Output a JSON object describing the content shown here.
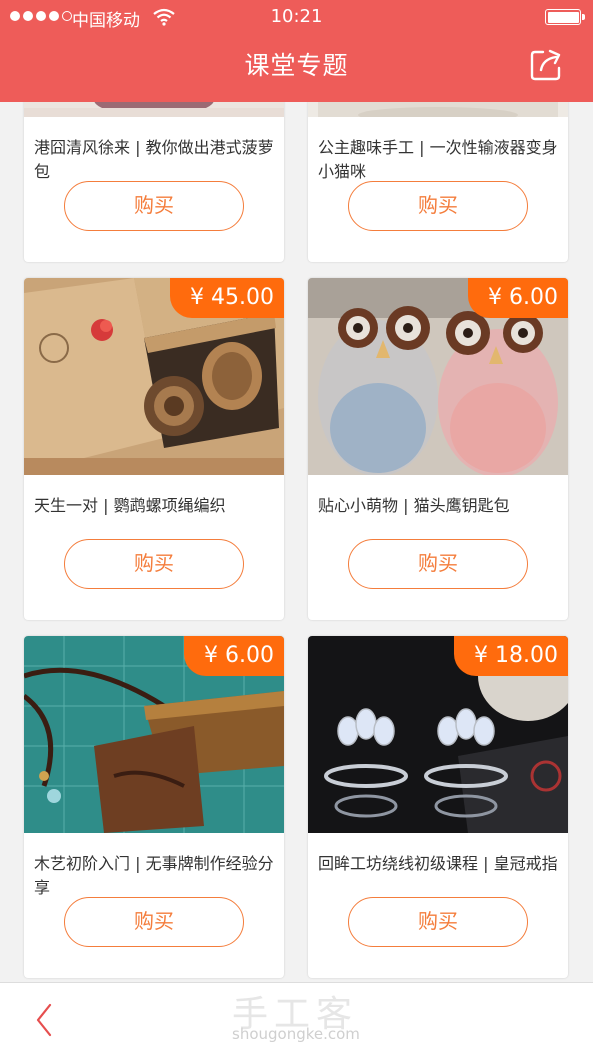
{
  "status_bar": {
    "carrier": "中国移动",
    "time": "10:21"
  },
  "header": {
    "title": "课堂专题",
    "share_icon": "share-icon"
  },
  "courses": [
    {
      "title": "港囧清风徐来 | 教你做出港式菠萝包",
      "price": "",
      "buy_label": "购买"
    },
    {
      "title": "公主趣味手工 | 一次性输液器变身小猫咪",
      "price": "",
      "buy_label": "购买"
    },
    {
      "title": "天生一对 | 鹦鹉螺项绳编织",
      "price": "¥ 45.00",
      "buy_label": "购买"
    },
    {
      "title": "贴心小萌物 | 猫头鹰钥匙包",
      "price": "¥ 6.00",
      "buy_label": "购买"
    },
    {
      "title": "木艺初阶入门 | 无事牌制作经验分享",
      "price": "¥ 6.00",
      "buy_label": "购买"
    },
    {
      "title": "回眸工坊绕线初级课程 | 皇冠戒指",
      "price": "¥ 18.00",
      "buy_label": "购买"
    }
  ],
  "watermark": {
    "cn": "手工客",
    "en": "shougongke.com"
  },
  "colors": {
    "header": "#ee5c59",
    "price_tag": "#ff6b0d",
    "buy_button": "#f47d3c"
  }
}
